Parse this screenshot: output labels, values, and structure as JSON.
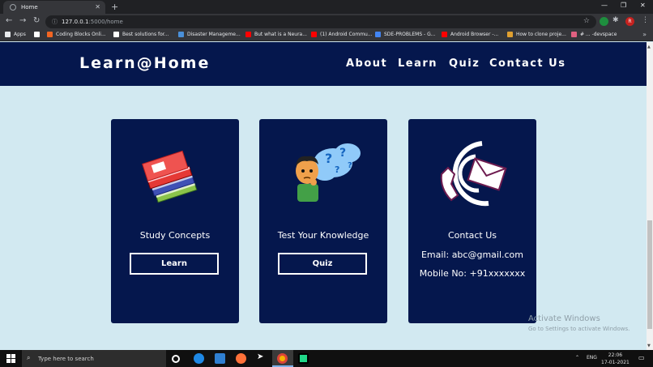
{
  "browser": {
    "tab_title": "Home",
    "url_host": "127.0.0.1",
    "url_path": ":5000/home",
    "avatar_letter": "R",
    "bookmarks": [
      {
        "label": "Apps",
        "icon": "apps-grid-icon",
        "color": "#e8eaed"
      },
      {
        "label": "",
        "icon": "github-icon",
        "color": "#ffffff"
      },
      {
        "label": "Coding Blocks Onli...",
        "icon": "coding-blocks-icon",
        "color": "#f26522"
      },
      {
        "label": "Best solutions for...",
        "icon": "medium-icon",
        "color": "#ffffff"
      },
      {
        "label": "Disaster Manageme...",
        "icon": "doc-icon",
        "color": "#4a90d9"
      },
      {
        "label": "But what is a Neura...",
        "icon": "youtube-icon",
        "color": "#ff0000"
      },
      {
        "label": "(1) Android Commu...",
        "icon": "youtube-icon",
        "color": "#ff0000"
      },
      {
        "label": "SDE-PROBLEMS - G...",
        "icon": "google-docs-icon",
        "color": "#4285f4"
      },
      {
        "label": "Android Browser -...",
        "icon": "youtube-icon",
        "color": "#ff0000"
      },
      {
        "label": "How to clone proje...",
        "icon": "pen-icon",
        "color": "#e0a030"
      },
      {
        "label": "# ... -devspace",
        "icon": "devspace-icon",
        "color": "#e06080"
      }
    ]
  },
  "site": {
    "brand": "Learn@Home",
    "nav": [
      "About",
      "Learn",
      "Quiz",
      "Contact Us"
    ],
    "colors": {
      "navbar": "#05174d",
      "page_bg": "#d2e9f1",
      "card": "#05174d"
    }
  },
  "cards": {
    "learn": {
      "title": "Study Concepts",
      "button": "Learn",
      "icon": "stacked-books-icon"
    },
    "quiz": {
      "title": "Test Your Knowledge",
      "button": "Quiz",
      "icon": "thinking-boy-icon"
    },
    "contact": {
      "title": "Contact Us",
      "email": "Email: abc@gmail.com",
      "mobile": "Mobile No: +91xxxxxxx",
      "icon": "phone-at-mail-icon"
    }
  },
  "watermark": {
    "line1": "Activate Windows",
    "line2": "Go to Settings to activate Windows."
  },
  "taskbar": {
    "search_placeholder": "Type here to search",
    "language": "ENG",
    "time": "22:06",
    "date": "17-01-2021"
  }
}
